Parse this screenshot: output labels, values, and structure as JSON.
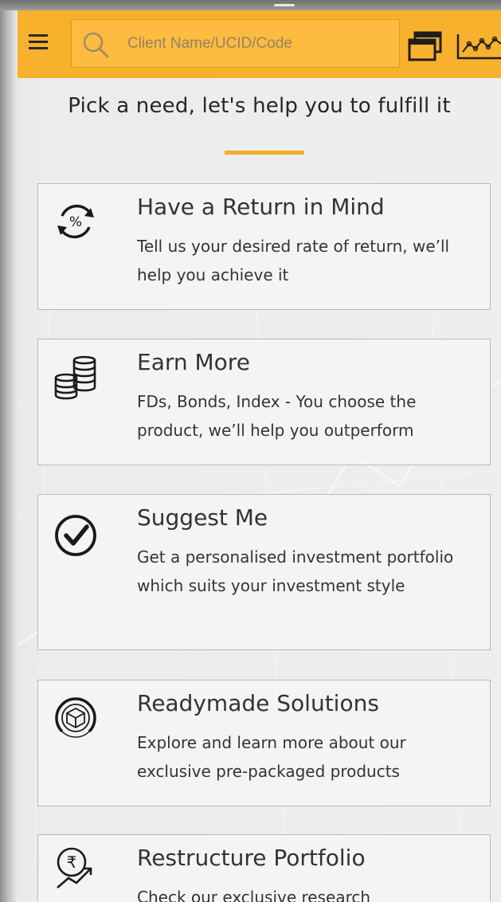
{
  "header": {
    "search_placeholder": "Client Name/UCID/Code",
    "icons": [
      "menu-icon",
      "search-icon",
      "windows-icon",
      "chart-icon"
    ],
    "brand_color": "#f8b12c"
  },
  "page": {
    "title": "Pick a need, let's help you to fulfill it",
    "accent_color": "#f3ae27"
  },
  "cards": [
    {
      "icon": "percent-cycle-icon",
      "title": "Have a Return in Mind",
      "desc": "Tell us your desired rate of return, we’ll help you achieve it"
    },
    {
      "icon": "coins-stack-icon",
      "title": "Earn More",
      "desc": "FDs, Bonds, Index - You choose the product, we’ll help you outperform"
    },
    {
      "icon": "checkmark-circle-icon",
      "title": "Suggest Me",
      "desc": "Get a personalised investment portfolio which suits your investment style"
    },
    {
      "icon": "box-circle-icon",
      "title": "Readymade Solutions",
      "desc": "Explore and learn more about our exclusive pre-packaged products"
    },
    {
      "icon": "rupee-trend-icon",
      "title": "Restructure Portfolio",
      "desc": "Check our exclusive research"
    }
  ]
}
